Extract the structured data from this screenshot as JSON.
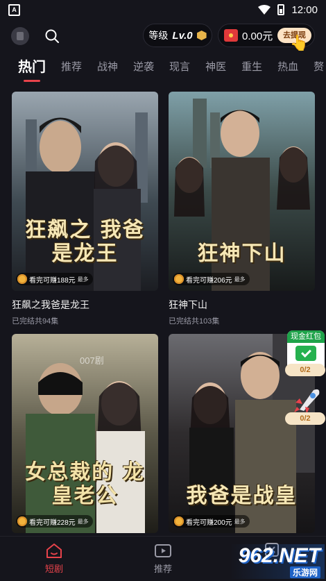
{
  "status_bar": {
    "time": "12:00",
    "notification_letter": "A"
  },
  "top_bar": {
    "level_label": "等级",
    "level_value": "Lv.0",
    "balance": "0.00元",
    "withdraw_label": "去提现"
  },
  "tabs": [
    "热门",
    "推荐",
    "战神",
    "逆袭",
    "现言",
    "神医",
    "重生",
    "热血",
    "赘"
  ],
  "cards": [
    {
      "title": "狂飙之我爸是龙王",
      "status": "已完结共94集",
      "poster_text": "狂飙之 我爸是龙王",
      "earn": "看完可赚188元",
      "earn_more": "最多"
    },
    {
      "title": "狂神下山",
      "status": "已完结共103集",
      "poster_text": "狂神下山",
      "earn": "看完可赚206元",
      "earn_more": "最多"
    },
    {
      "title": "",
      "status": "",
      "poster_text": "女总裁的 龙皇老公",
      "earn": "看完可赚228元",
      "earn_more": "最多",
      "overlay": "007剧"
    },
    {
      "title": "",
      "status": "",
      "poster_text": "我爸是战皇",
      "earn": "看完可赚200元",
      "earn_more": "最多"
    }
  ],
  "floating": {
    "redpack_label": "现金红包",
    "redpack_count": "0/2",
    "rocket_count": "0/2"
  },
  "bottom_nav": [
    {
      "label": "短剧",
      "active": true
    },
    {
      "label": "推荐",
      "active": false
    },
    {
      "label": "",
      "active": false
    }
  ],
  "watermark": {
    "big": "962.NET",
    "small": "乐游网"
  },
  "colors": {
    "accent": "#e8434b",
    "background": "#15151c",
    "gold": "#f2b33d",
    "green": "#1fa34a"
  }
}
